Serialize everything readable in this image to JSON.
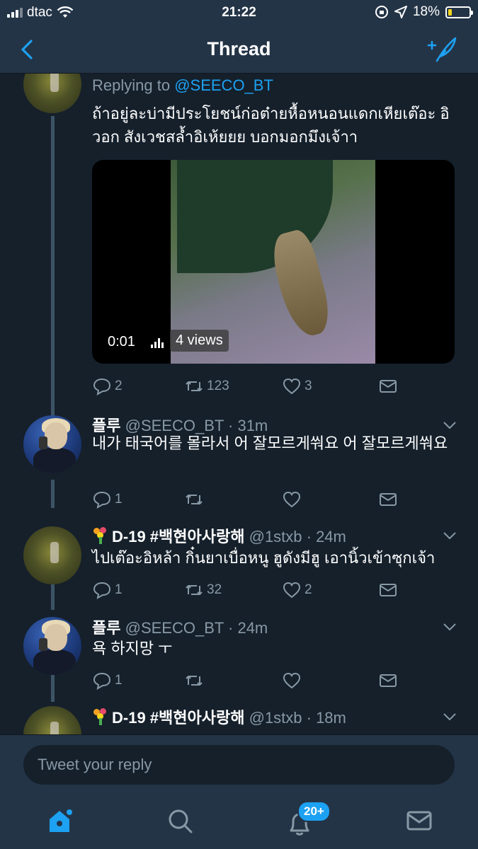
{
  "status_bar": {
    "carrier": "dtac",
    "time": "21:22",
    "battery": "18%",
    "battery_level": 0.18
  },
  "nav": {
    "title": "Thread"
  },
  "tweets": [
    {
      "replying_prefix": "Replying to",
      "replying_handle": "@SEECO_BT",
      "text": "ถ้าอยู่ละบ่ามีประโยชน์ก่อต๋ายหื้อหนอนแดกเหียเต๊อะ อิวอก สังเวชสล้ำอิเห้ยยย บอกมอกมึงเจ้าา",
      "video": {
        "time": "0:01",
        "views": "4 views"
      },
      "actions": {
        "replies": "2",
        "retweets": "123",
        "likes": "3"
      }
    },
    {
      "name": "플루",
      "handle": "@SEECO_BT · 31m",
      "text": "내가 태국어를 몰라서 어 잘모르게쒀요 어 잘모르게쒀요",
      "actions": {
        "replies": "1",
        "retweets": "",
        "likes": ""
      }
    },
    {
      "name": "D-19 #백현아사랑해",
      "handle": "@1stxb · 24m",
      "text": "ไปเต๊อะอิหล้า กิ๋นยาเบื่อหนู ฮูดังมีฮู เอานิ้วเข้าซุกเจ้า",
      "actions": {
        "replies": "1",
        "retweets": "32",
        "likes": "2"
      }
    },
    {
      "name": "플루",
      "handle": "@SEECO_BT · 24m",
      "text": "욕 하지망 ㅜ",
      "actions": {
        "replies": "1",
        "retweets": "",
        "likes": ""
      }
    },
    {
      "name": "D-19 #백현아사랑해",
      "handle": "@1stxb · 18m"
    }
  ],
  "reply": {
    "placeholder": "Tweet your reply"
  },
  "tabbar": {
    "notifications_badge": "20+"
  },
  "colors": {
    "background": "#15202b",
    "bar": "#243447",
    "accent": "#1da1f2",
    "muted": "#8899a6"
  }
}
